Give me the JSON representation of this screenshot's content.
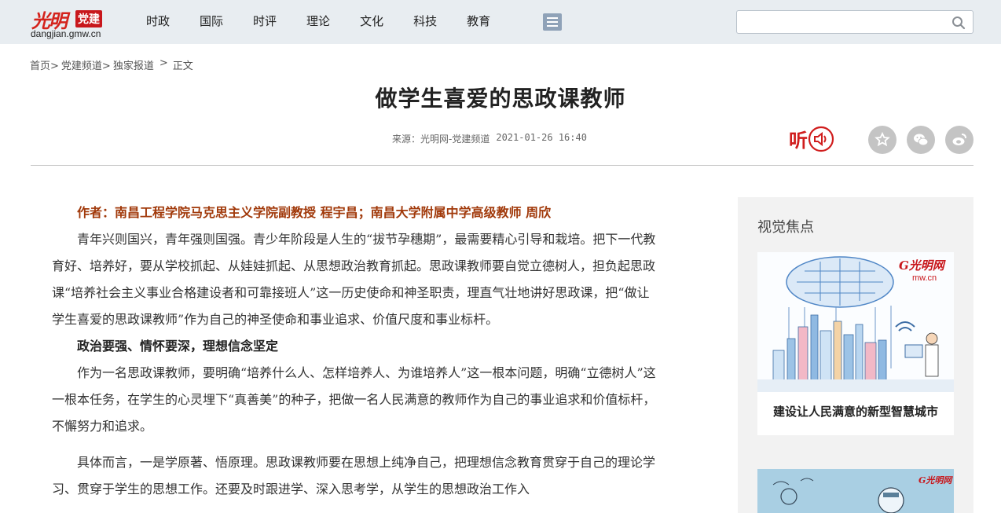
{
  "header": {
    "logo_mark": "光明",
    "logo_tag": "党建",
    "logo_domain": "dangjian.gmw.cn",
    "nav": [
      "时政",
      "国际",
      "时评",
      "理论",
      "文化",
      "科技",
      "教育"
    ],
    "menu_icon": "list-menu-icon",
    "search": {
      "value": "",
      "placeholder": ""
    },
    "search_icon": "search-icon"
  },
  "breadcrumb": [
    "首页>",
    "党建频道>",
    "独家报道",
    ">",
    "正文"
  ],
  "article": {
    "title": "做学生喜爱的思政课教师",
    "source": "来源：光明网-党建频道",
    "time": "2021-01-26 16:40",
    "listen_label": "听",
    "share_icons": [
      "favorite-icon",
      "wechat-icon",
      "weibo-icon"
    ],
    "author": "作者：南昌工程学院马克思主义学院副教授 程宇昌；南昌大学附属中学高级教师 周欣",
    "p1": "青年兴则国兴，青年强则国强。青少年阶段是人生的“拔节孕穗期”，最需要精心引导和栽培。把下一代教育好、培养好，要从学校抓起、从娃娃抓起、从思想政治教育抓起。思政课教师要自觉立德树人，担负起思政课“培养社会主义事业合格建设者和可靠接班人”这一历史使命和神圣职责，理直气壮地讲好思政课，把“做让学生喜爱的思政课教师”作为自己的神圣使命和事业追求、价值尺度和事业标杆。",
    "subheading": "政治要强、情怀要深，理想信念坚定",
    "p2": "作为一名思政课教师，要明确“培养什么人、怎样培养人、为谁培养人”这一根本问题，明确“立德树人”这一根本任务，在学生的心灵埋下“真善美”的种子，把做一名人民满意的教师作为自己的事业追求和价值标杆，不懈努力和追求。",
    "p3": "具体而言，一是学原著、悟原理。思政课教师要在思想上纯净自己，把理想信念教育贯穿于自己的理论学习、贯穿于学生的思想工作。还要及时跟进学、深入思考学，从学生的思想政治工作入"
  },
  "sidebar": {
    "title": "视觉焦点",
    "card1_caption": "建设让人民满意的新型智慧城市",
    "watermark": "G光明网 mw.cn"
  }
}
